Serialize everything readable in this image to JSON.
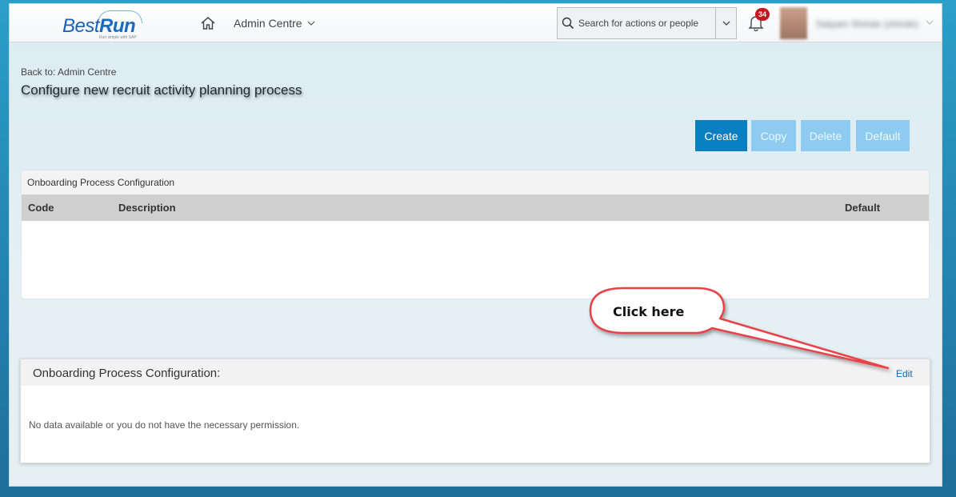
{
  "header": {
    "logo_text_1": "Best",
    "logo_text_2": "Run",
    "logo_tagline": "Run simple with SAP",
    "nav_title": "Admin Centre",
    "search_placeholder": "Search for actions or people",
    "notification_count": "34",
    "user_name": "Satyam Shinde (shinde)"
  },
  "page": {
    "back_link": "Back to: Admin Centre",
    "title": "Configure new recruit activity planning process"
  },
  "toolbar": {
    "create_label": "Create",
    "copy_label": "Copy",
    "delete_label": "Delete",
    "default_label": "Default"
  },
  "table_panel": {
    "title": "Onboarding Process Configuration",
    "columns": [
      "Code",
      "Description",
      "Default"
    ]
  },
  "detail_panel": {
    "title": "Onboarding Process Configuration:",
    "edit_label": "Edit",
    "empty_message": "No data available or you do not have the necessary permission."
  },
  "callout": {
    "text": "Click here"
  },
  "colors": {
    "primary_button": "#0a7fc2",
    "disabled_button": "#8ecbf0",
    "callout_border": "#e8434a",
    "badge": "#c8141e"
  }
}
